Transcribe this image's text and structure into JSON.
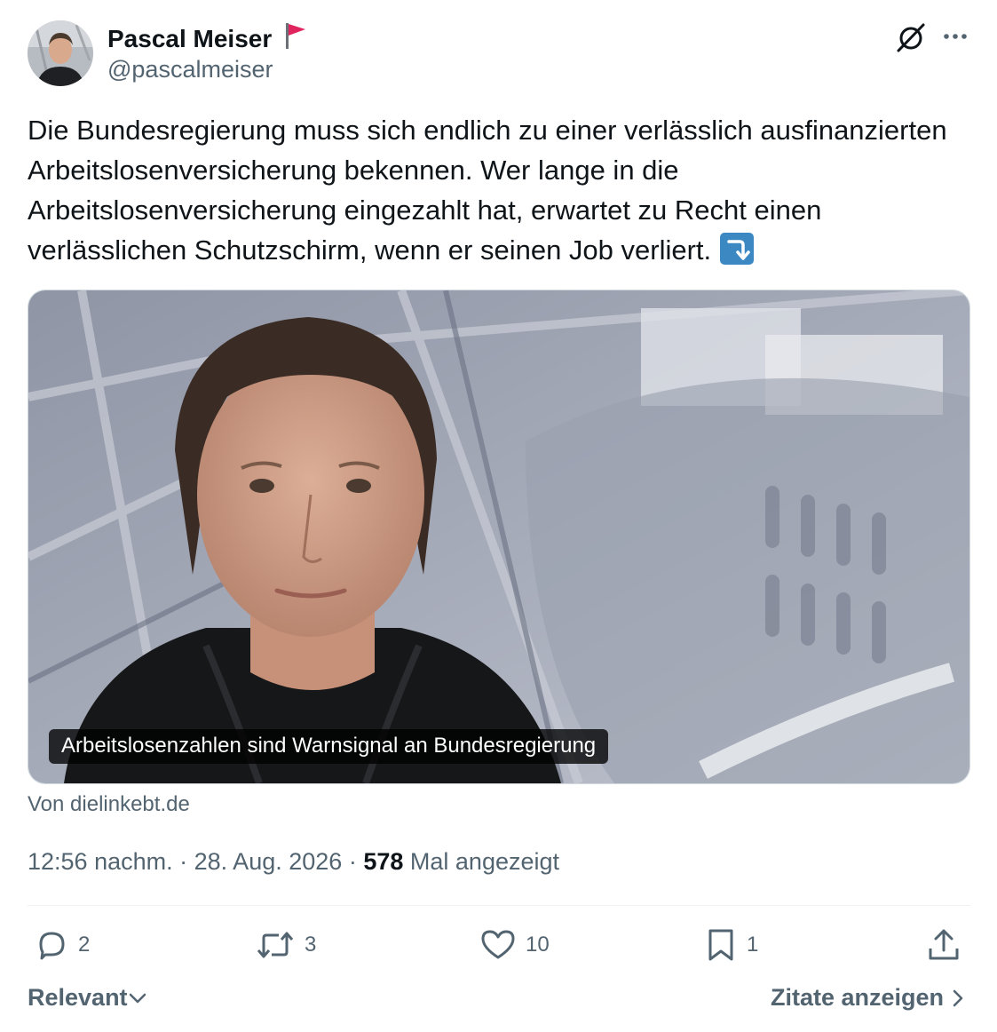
{
  "author": {
    "name": "Pascal Meiser",
    "handle": "@pascalmeiser",
    "flag_icon": "red-flag-icon"
  },
  "tweet": {
    "text": "Die Bundesregierung muss sich endlich zu einer verlässlich ausfinanzierten Arbeitslosenversicherung bekennen. Wer lange in die Arbeitslosenversicherung eingezahlt hat, erwartet zu Recht einen verlässlichen Schutzschirm, wenn er seinen Job verliert.",
    "emoji": "right-arrow-curving-down-emoji"
  },
  "link_card": {
    "title": "Arbeitslosenzahlen sind Warnsignal an Bundesregierung",
    "source": "Von dielinkebt.de"
  },
  "meta": {
    "time": "12:56 nachm.",
    "separator": "·",
    "date": "28. Aug. 2026",
    "views_count": "578",
    "views_label": "Mal angezeigt"
  },
  "actions": {
    "replies": "2",
    "reposts": "3",
    "likes": "10",
    "bookmarks": "1"
  },
  "footer": {
    "sort_label": "Relevant",
    "quotes_label": "Zitate anzeigen"
  },
  "colors": {
    "text": "#0f1419",
    "secondary": "#536471",
    "flag": "#e0245e",
    "emoji_blue": "#3b88c3"
  }
}
